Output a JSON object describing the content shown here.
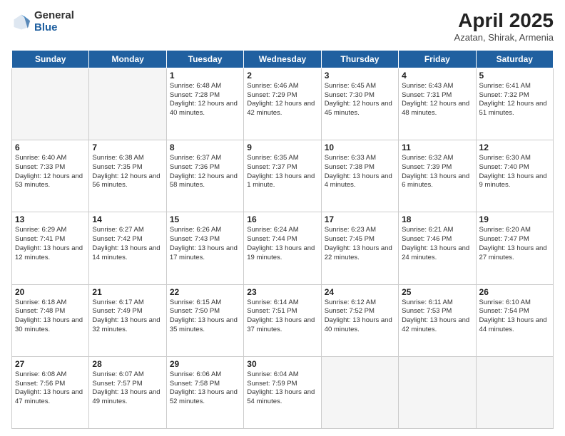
{
  "logo": {
    "general": "General",
    "blue": "Blue"
  },
  "title": {
    "month": "April 2025",
    "location": "Azatan, Shirak, Armenia"
  },
  "weekdays": [
    "Sunday",
    "Monday",
    "Tuesday",
    "Wednesday",
    "Thursday",
    "Friday",
    "Saturday"
  ],
  "weeks": [
    [
      {
        "day": "",
        "info": ""
      },
      {
        "day": "",
        "info": ""
      },
      {
        "day": "1",
        "info": "Sunrise: 6:48 AM\nSunset: 7:28 PM\nDaylight: 12 hours and 40 minutes."
      },
      {
        "day": "2",
        "info": "Sunrise: 6:46 AM\nSunset: 7:29 PM\nDaylight: 12 hours and 42 minutes."
      },
      {
        "day": "3",
        "info": "Sunrise: 6:45 AM\nSunset: 7:30 PM\nDaylight: 12 hours and 45 minutes."
      },
      {
        "day": "4",
        "info": "Sunrise: 6:43 AM\nSunset: 7:31 PM\nDaylight: 12 hours and 48 minutes."
      },
      {
        "day": "5",
        "info": "Sunrise: 6:41 AM\nSunset: 7:32 PM\nDaylight: 12 hours and 51 minutes."
      }
    ],
    [
      {
        "day": "6",
        "info": "Sunrise: 6:40 AM\nSunset: 7:33 PM\nDaylight: 12 hours and 53 minutes."
      },
      {
        "day": "7",
        "info": "Sunrise: 6:38 AM\nSunset: 7:35 PM\nDaylight: 12 hours and 56 minutes."
      },
      {
        "day": "8",
        "info": "Sunrise: 6:37 AM\nSunset: 7:36 PM\nDaylight: 12 hours and 58 minutes."
      },
      {
        "day": "9",
        "info": "Sunrise: 6:35 AM\nSunset: 7:37 PM\nDaylight: 13 hours and 1 minute."
      },
      {
        "day": "10",
        "info": "Sunrise: 6:33 AM\nSunset: 7:38 PM\nDaylight: 13 hours and 4 minutes."
      },
      {
        "day": "11",
        "info": "Sunrise: 6:32 AM\nSunset: 7:39 PM\nDaylight: 13 hours and 6 minutes."
      },
      {
        "day": "12",
        "info": "Sunrise: 6:30 AM\nSunset: 7:40 PM\nDaylight: 13 hours and 9 minutes."
      }
    ],
    [
      {
        "day": "13",
        "info": "Sunrise: 6:29 AM\nSunset: 7:41 PM\nDaylight: 13 hours and 12 minutes."
      },
      {
        "day": "14",
        "info": "Sunrise: 6:27 AM\nSunset: 7:42 PM\nDaylight: 13 hours and 14 minutes."
      },
      {
        "day": "15",
        "info": "Sunrise: 6:26 AM\nSunset: 7:43 PM\nDaylight: 13 hours and 17 minutes."
      },
      {
        "day": "16",
        "info": "Sunrise: 6:24 AM\nSunset: 7:44 PM\nDaylight: 13 hours and 19 minutes."
      },
      {
        "day": "17",
        "info": "Sunrise: 6:23 AM\nSunset: 7:45 PM\nDaylight: 13 hours and 22 minutes."
      },
      {
        "day": "18",
        "info": "Sunrise: 6:21 AM\nSunset: 7:46 PM\nDaylight: 13 hours and 24 minutes."
      },
      {
        "day": "19",
        "info": "Sunrise: 6:20 AM\nSunset: 7:47 PM\nDaylight: 13 hours and 27 minutes."
      }
    ],
    [
      {
        "day": "20",
        "info": "Sunrise: 6:18 AM\nSunset: 7:48 PM\nDaylight: 13 hours and 30 minutes."
      },
      {
        "day": "21",
        "info": "Sunrise: 6:17 AM\nSunset: 7:49 PM\nDaylight: 13 hours and 32 minutes."
      },
      {
        "day": "22",
        "info": "Sunrise: 6:15 AM\nSunset: 7:50 PM\nDaylight: 13 hours and 35 minutes."
      },
      {
        "day": "23",
        "info": "Sunrise: 6:14 AM\nSunset: 7:51 PM\nDaylight: 13 hours and 37 minutes."
      },
      {
        "day": "24",
        "info": "Sunrise: 6:12 AM\nSunset: 7:52 PM\nDaylight: 13 hours and 40 minutes."
      },
      {
        "day": "25",
        "info": "Sunrise: 6:11 AM\nSunset: 7:53 PM\nDaylight: 13 hours and 42 minutes."
      },
      {
        "day": "26",
        "info": "Sunrise: 6:10 AM\nSunset: 7:54 PM\nDaylight: 13 hours and 44 minutes."
      }
    ],
    [
      {
        "day": "27",
        "info": "Sunrise: 6:08 AM\nSunset: 7:56 PM\nDaylight: 13 hours and 47 minutes."
      },
      {
        "day": "28",
        "info": "Sunrise: 6:07 AM\nSunset: 7:57 PM\nDaylight: 13 hours and 49 minutes."
      },
      {
        "day": "29",
        "info": "Sunrise: 6:06 AM\nSunset: 7:58 PM\nDaylight: 13 hours and 52 minutes."
      },
      {
        "day": "30",
        "info": "Sunrise: 6:04 AM\nSunset: 7:59 PM\nDaylight: 13 hours and 54 minutes."
      },
      {
        "day": "",
        "info": ""
      },
      {
        "day": "",
        "info": ""
      },
      {
        "day": "",
        "info": ""
      }
    ]
  ]
}
